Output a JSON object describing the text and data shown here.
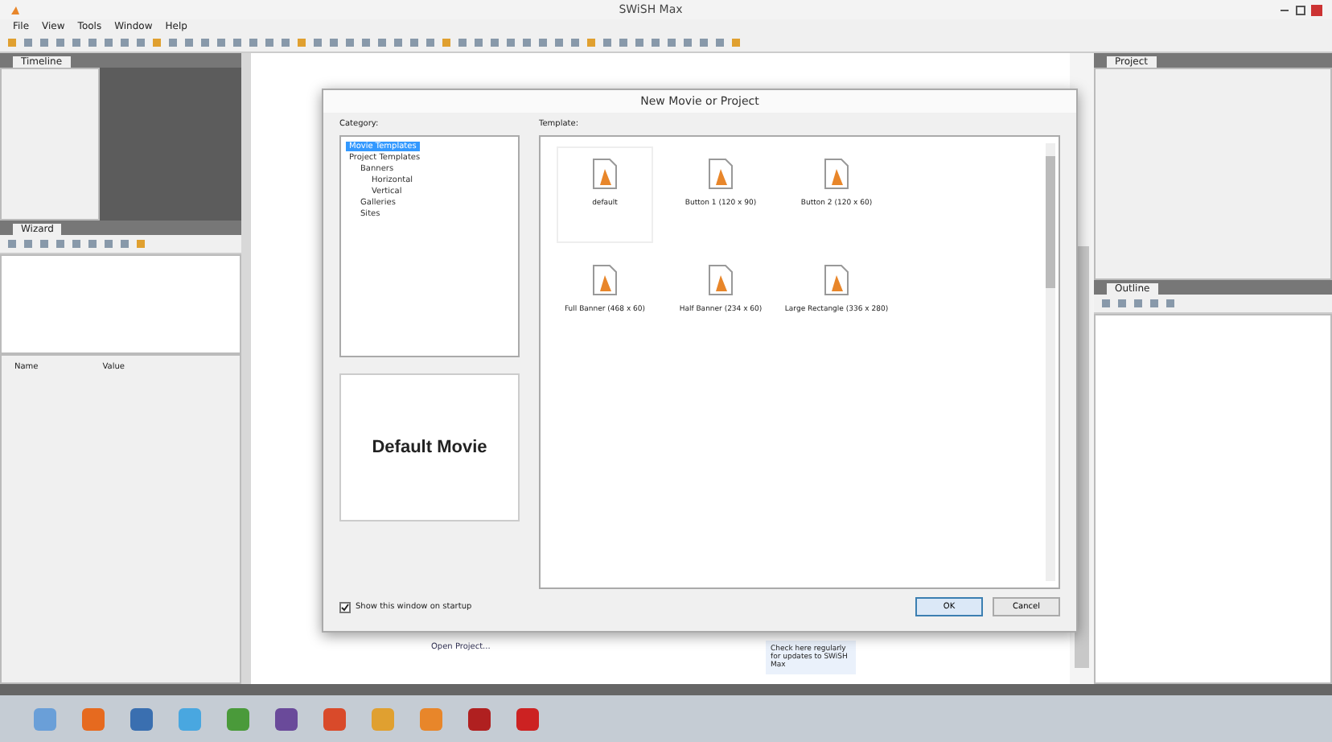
{
  "window": {
    "title": "SWiSH Max"
  },
  "menu": [
    "File",
    "View",
    "Tools",
    "Window",
    "Help"
  ],
  "left_panels": {
    "timeline_tab": "Timeline",
    "wizard_tab": "Wizard",
    "columns": [
      "Name",
      "Value"
    ]
  },
  "right_panels": {
    "project_tab": "Project",
    "outline_tab": "Outline"
  },
  "start_page": {
    "open_project": "Open Project...",
    "updates_note": "Check here regularly for updates to SWiSH Max"
  },
  "dialog": {
    "title": "New Movie or Project",
    "category_label": "Category:",
    "template_label": "Template:",
    "categories": [
      {
        "label": "Movie Templates",
        "selected": true
      },
      {
        "label": "Project Templates",
        "selected": false,
        "children": [
          {
            "label": "Banners",
            "selected": false,
            "children": [
              {
                "label": "Horizontal",
                "selected": false
              },
              {
                "label": "Vertical",
                "selected": false
              }
            ]
          },
          {
            "label": "Galleries",
            "selected": false
          },
          {
            "label": "Sites",
            "selected": false
          }
        ]
      }
    ],
    "templates": [
      {
        "label": "default",
        "selected": true
      },
      {
        "label": "Button 1 (120 x 90)",
        "selected": false
      },
      {
        "label": "Button 2 (120 x 60)",
        "selected": false
      },
      {
        "label": "Full Banner (468 x 60)",
        "selected": false
      },
      {
        "label": "Half Banner (234 x 60)",
        "selected": false
      },
      {
        "label": "Large Rectangle (336 x 280)",
        "selected": false
      }
    ],
    "preview_text": "Default Movie",
    "show_on_startup": {
      "label": "Show this window on startup",
      "checked": true
    },
    "buttons": [
      {
        "label": "OK",
        "default": true
      },
      {
        "label": "Cancel",
        "default": false
      }
    ]
  }
}
